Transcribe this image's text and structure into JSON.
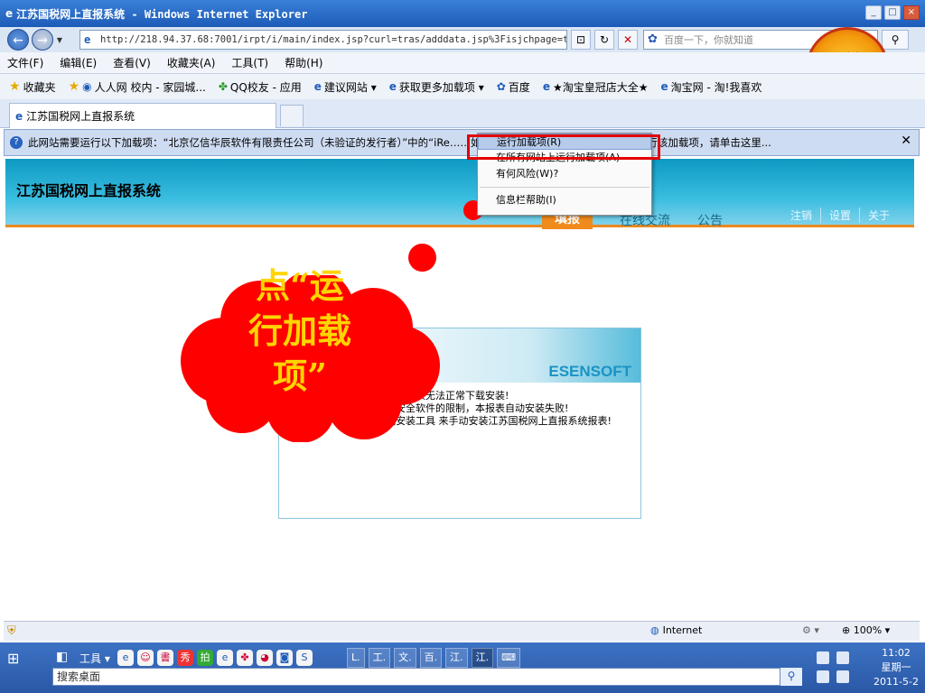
{
  "window": {
    "title": "江苏国税网上直报系统 - Windows Internet Explorer",
    "minimize": "_",
    "maximize": "□",
    "close": "×"
  },
  "addressbar": {
    "url": "http://218.94.37.68:7001/irpt/i/main/index.jsp?curl=tras/adddata.jsp%3Fisjchpage=tr",
    "search_placeholder": "百度一下，你就知道"
  },
  "menu": [
    "文件(F)",
    "编辑(E)",
    "查看(V)",
    "收藏夹(A)",
    "工具(T)",
    "帮助(H)"
  ],
  "favorites": {
    "label": "收藏夹",
    "items": [
      "人人网 校内 - 家园城...",
      "QQ校友 - 应用",
      "建议网站 ▾",
      "获取更多加载项 ▾",
      "百度",
      "★淘宝皇冠店大全★",
      "淘宝网 - 淘!我喜欢"
    ]
  },
  "tab": {
    "title": "江苏国税网上直报系统"
  },
  "infobar": {
    "text": "此网站需要运行以下加载项：“北京亿信华辰软件有限责任公司（未验证的发行者）”中的“iRe……如果您信任该网站和该加载项并允许运行该加载项，请单击这里..."
  },
  "context_menu": {
    "items": [
      "运行加载项(R)",
      "在所有网站上运行加载项(A)",
      "有何风险(W)?",
      "信息栏帮助(I)"
    ]
  },
  "site": {
    "title": "江苏国税网上直报系统",
    "nav": [
      "填报",
      "在线交流",
      "公告"
    ],
    "links": [
      "注销",
      "设置",
      "关于"
    ],
    "seal_char": "税"
  },
  "panel": {
    "brand": "ESENSOFT",
    "lines": [
      "系统报表无法正常下载安装!",
      "上安全软件的限制，本报表自动安装失败!",
      "载安装工具 来手动安装江苏国税网上直报系统报表!"
    ]
  },
  "callout": {
    "lines": [
      "点“运",
      "行加载",
      "项”"
    ],
    "color": "#ffd400",
    "cloud_color": "#ff0000"
  },
  "statusbar": {
    "zone": "Internet",
    "zoom": "100%"
  },
  "taskbar": {
    "tools_label": "工具",
    "tasks": [
      "L.",
      "工.",
      "文.",
      "百.",
      "江.",
      "江."
    ],
    "search_placeholder": "搜索桌面",
    "time": "11:02",
    "weekday": "星期一",
    "date": "2011-5-2"
  }
}
